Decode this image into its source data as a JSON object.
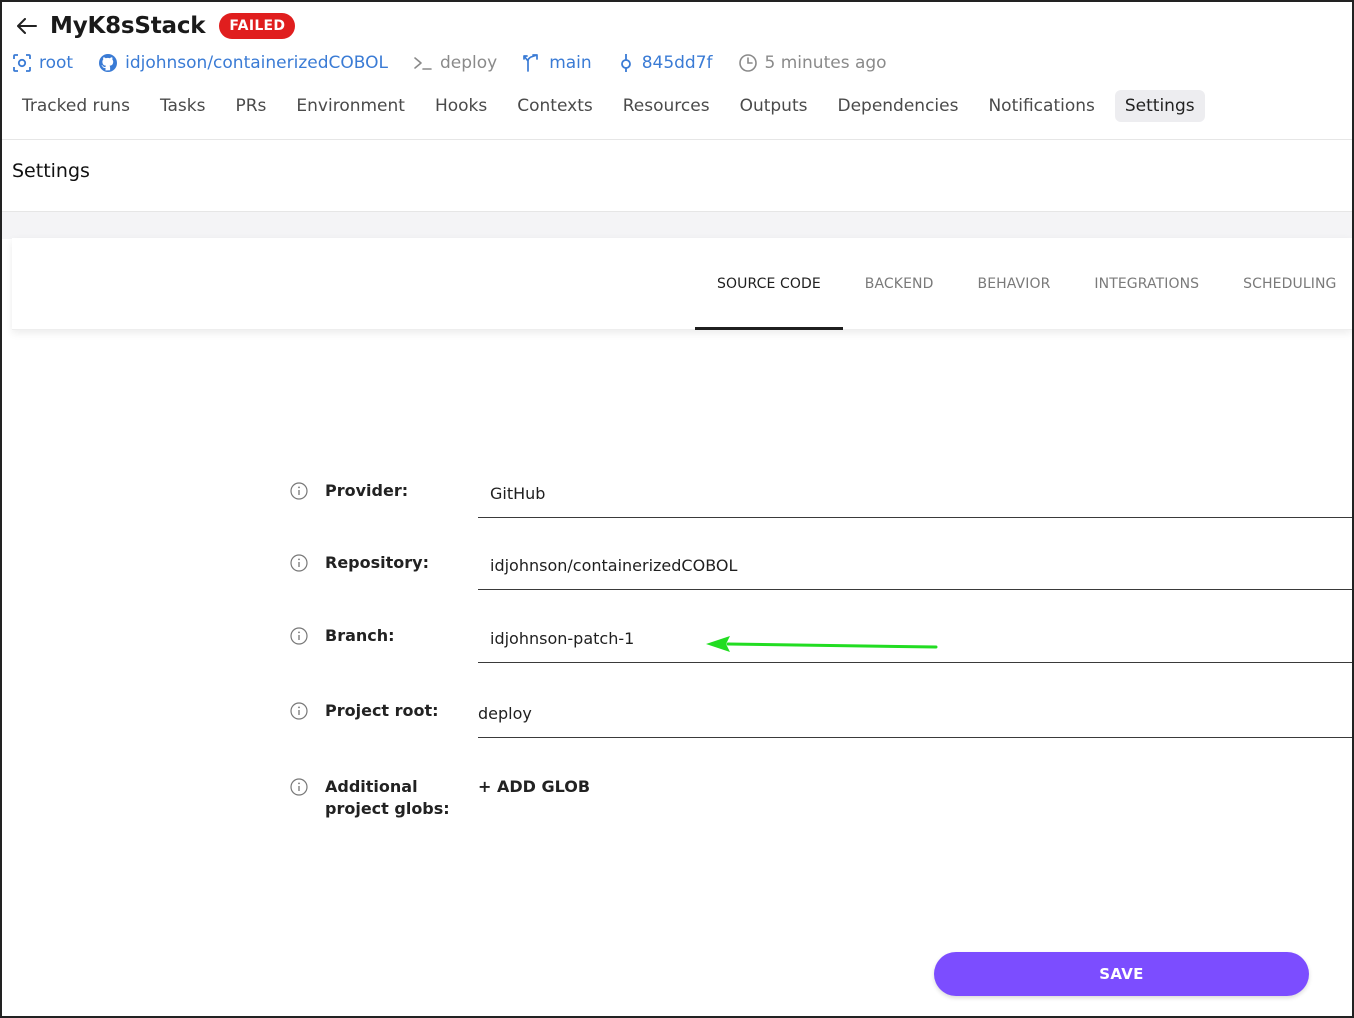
{
  "header": {
    "title": "MyK8sStack",
    "status_badge": "FAILED"
  },
  "meta": {
    "space": "root",
    "repository": "idjohnson/containerizedCOBOL",
    "project_root": "deploy",
    "branch": "main",
    "commit": "845dd7f",
    "time": "5 minutes ago"
  },
  "nav_tabs": [
    {
      "label": "Tracked runs"
    },
    {
      "label": "Tasks"
    },
    {
      "label": "PRs"
    },
    {
      "label": "Environment"
    },
    {
      "label": "Hooks"
    },
    {
      "label": "Contexts"
    },
    {
      "label": "Resources"
    },
    {
      "label": "Outputs"
    },
    {
      "label": "Dependencies"
    },
    {
      "label": "Notifications"
    },
    {
      "label": "Settings",
      "active": true
    }
  ],
  "page_title": "Settings",
  "sub_tabs": [
    {
      "label": "SOURCE CODE",
      "active": true
    },
    {
      "label": "BACKEND"
    },
    {
      "label": "BEHAVIOR"
    },
    {
      "label": "INTEGRATIONS"
    },
    {
      "label": "SCHEDULING"
    }
  ],
  "form": {
    "provider": {
      "label": "Provider:",
      "value": "GitHub"
    },
    "repository": {
      "label": "Repository:",
      "value": "idjohnson/containerizedCOBOL"
    },
    "branch": {
      "label": "Branch:",
      "value": "idjohnson-patch-1"
    },
    "project_root": {
      "label": "Project root:",
      "value": "deploy"
    },
    "additional_globs": {
      "label_line1": "Additional",
      "label_line2": "project globs:",
      "add_label": "+ ADD GLOB"
    }
  },
  "save_label": "SAVE",
  "colors": {
    "accent": "#7c4dff",
    "failed": "#e01e1e",
    "link": "#3a7bd5",
    "annotation_arrow": "#22dd22"
  },
  "icons": [
    "back-arrow-icon",
    "space-icon",
    "github-icon",
    "terminal-icon",
    "branch-icon",
    "commit-icon",
    "clock-icon",
    "info-icon"
  ]
}
